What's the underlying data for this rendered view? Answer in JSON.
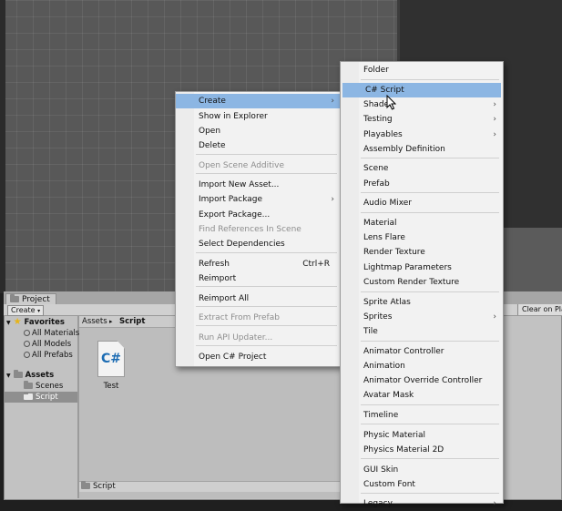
{
  "project_window": {
    "tab_label": "Project",
    "create_label": "Create",
    "create_arrow": "▾",
    "clear_label": "Clear on Play",
    "breadcrumb": [
      "Assets",
      "Script"
    ],
    "breadcrumb_separator": "▸",
    "favorites": {
      "label": "Favorites",
      "items": [
        "All Materials",
        "All Models",
        "All Prefabs"
      ]
    },
    "assets": {
      "label": "Assets",
      "items": [
        "Scenes",
        "Script"
      ],
      "selected": "Script"
    },
    "file": {
      "name": "Test",
      "glyph": "C#"
    },
    "footer_path": "Script"
  },
  "context_menu": {
    "items": [
      {
        "label": "Create",
        "submenu": true,
        "highlighted": true
      },
      {
        "label": "Show in Explorer"
      },
      {
        "label": "Open"
      },
      {
        "label": "Delete"
      },
      {
        "label": "Open Scene Additive",
        "disabled": true
      },
      {
        "label": "Import New Asset..."
      },
      {
        "label": "Import Package",
        "submenu": true
      },
      {
        "label": "Export Package..."
      },
      {
        "label": "Find References In Scene",
        "disabled": true
      },
      {
        "label": "Select Dependencies"
      },
      {
        "label": "Refresh",
        "shortcut": "Ctrl+R"
      },
      {
        "label": "Reimport"
      },
      {
        "label": "Reimport All"
      },
      {
        "label": "Extract From Prefab",
        "disabled": true
      },
      {
        "label": "Run API Updater...",
        "disabled": true
      },
      {
        "label": "Open C# Project"
      }
    ]
  },
  "create_submenu": {
    "items": [
      {
        "label": "Folder"
      },
      {
        "label": "C# Script",
        "highlighted": true
      },
      {
        "label": "Shader",
        "submenu": true
      },
      {
        "label": "Testing",
        "submenu": true
      },
      {
        "label": "Playables",
        "submenu": true
      },
      {
        "label": "Assembly Definition"
      },
      {
        "label": "Scene"
      },
      {
        "label": "Prefab"
      },
      {
        "label": "Audio Mixer"
      },
      {
        "label": "Material"
      },
      {
        "label": "Lens Flare"
      },
      {
        "label": "Render Texture"
      },
      {
        "label": "Lightmap Parameters"
      },
      {
        "label": "Custom Render Texture"
      },
      {
        "label": "Sprite Atlas"
      },
      {
        "label": "Sprites",
        "submenu": true
      },
      {
        "label": "Tile"
      },
      {
        "label": "Animator Controller"
      },
      {
        "label": "Animation"
      },
      {
        "label": "Animator Override Controller"
      },
      {
        "label": "Avatar Mask"
      },
      {
        "label": "Timeline"
      },
      {
        "label": "Physic Material"
      },
      {
        "label": "Physics Material 2D"
      },
      {
        "label": "GUI Skin"
      },
      {
        "label": "Custom Font"
      },
      {
        "label": "Legacy",
        "submenu": true
      }
    ]
  },
  "icons": {
    "submenu_arrow": "›",
    "star": "★",
    "triangle_down": "▼"
  },
  "colors": {
    "highlight": "#8cb6e3",
    "menu_bg": "#f2f2f2",
    "scene_bg": "#585858",
    "panel_bg": "#c2c2c2"
  }
}
